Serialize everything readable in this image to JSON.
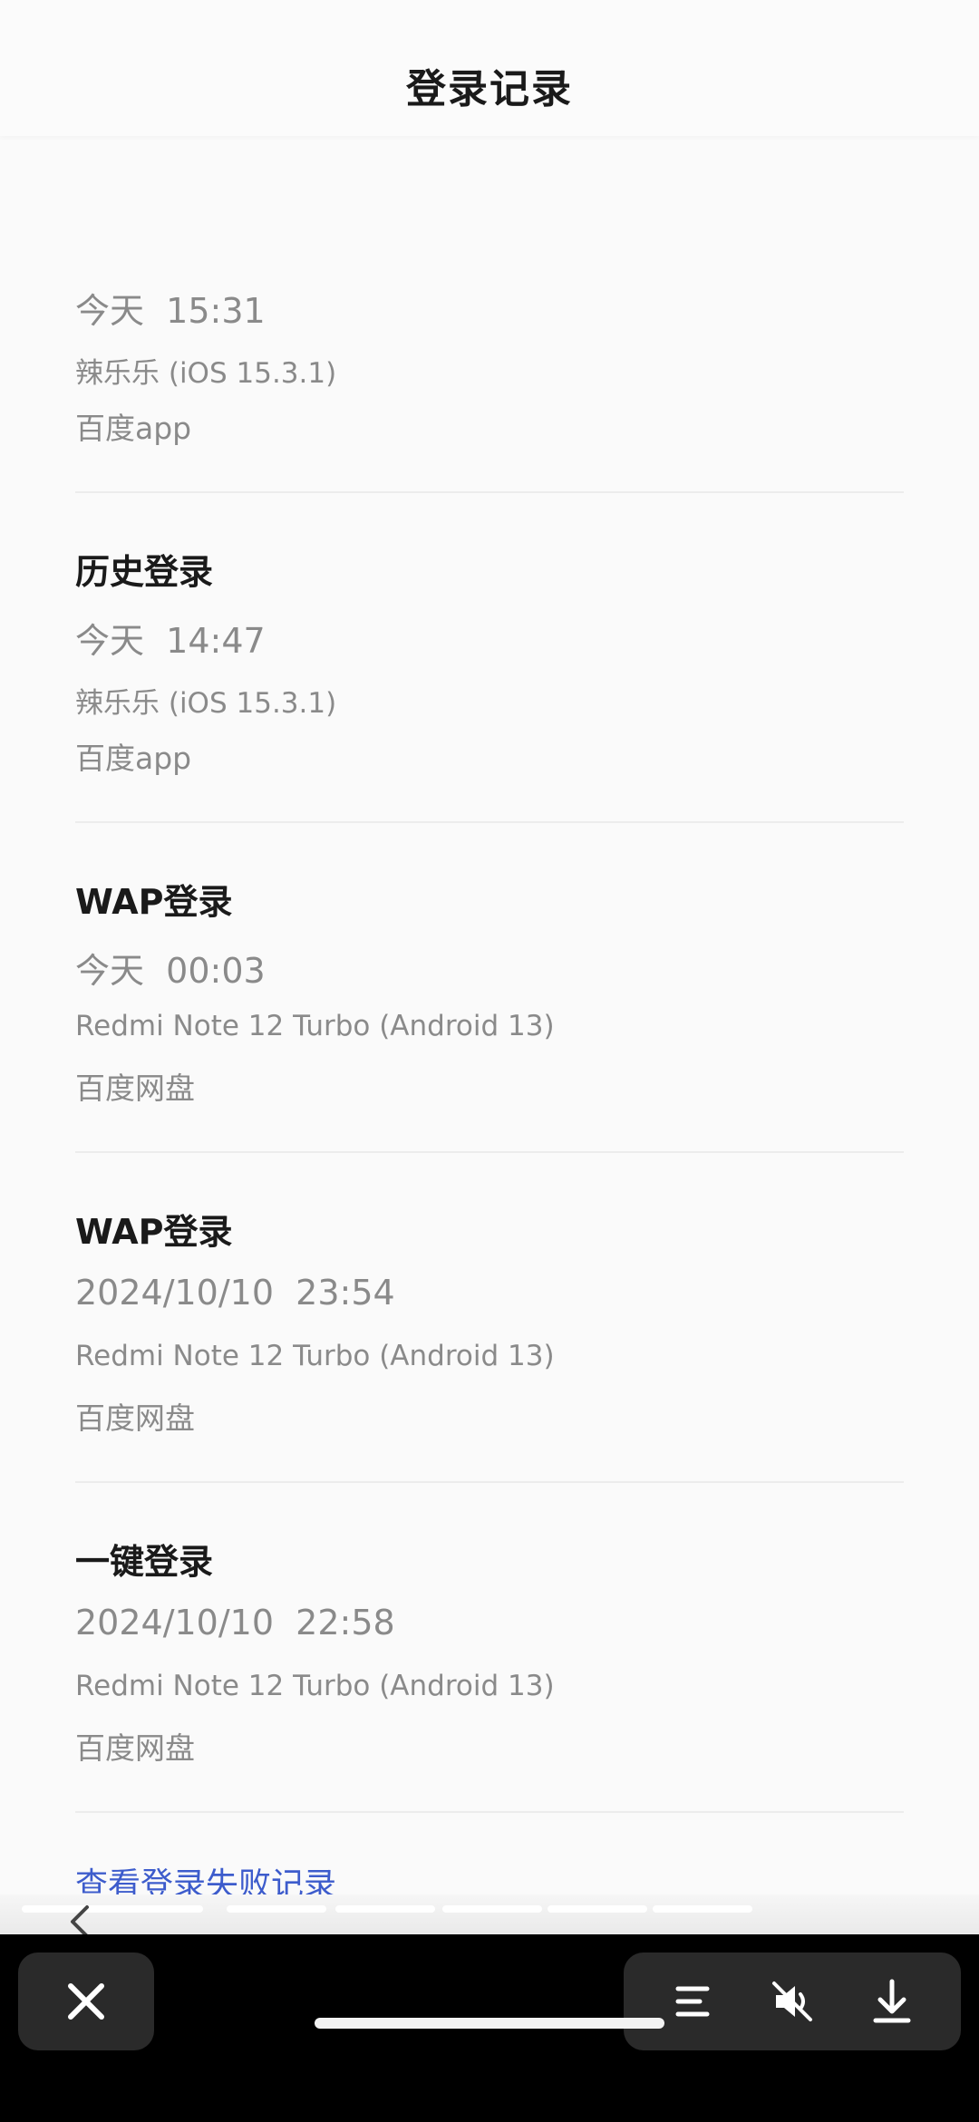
{
  "header": {
    "title": "登录记录"
  },
  "records": [
    {
      "title": "",
      "time": "今天  15:31",
      "device": "辣乐乐 (iOS 15.3.1)",
      "app": "百度app"
    },
    {
      "title": "历史登录",
      "time": "今天  14:47",
      "device": "辣乐乐 (iOS 15.3.1)",
      "app": "百度app"
    },
    {
      "title": "WAP登录",
      "time": "今天  00:03",
      "device": "Redmi Note 12 Turbo (Android 13)",
      "app": "百度网盘"
    },
    {
      "title": "WAP登录",
      "time": "2024/10/10  23:54",
      "device": "Redmi Note 12 Turbo (Android 13)",
      "app": "百度网盘"
    },
    {
      "title": "一键登录",
      "time": "2024/10/10  22:58",
      "device": "Redmi Note 12 Turbo (Android 13)",
      "app": "百度网盘"
    }
  ],
  "footer": {
    "fail_link": "查看登录失败记录"
  },
  "icons": {
    "back": "chevron-left-icon",
    "close": "close-icon",
    "menu": "menu-icon",
    "mute": "speaker-muted-icon",
    "download": "download-icon"
  },
  "colors": {
    "link": "#3d5ccc",
    "muted_text": "#8a8a8a",
    "bar_bg": "#000000"
  }
}
